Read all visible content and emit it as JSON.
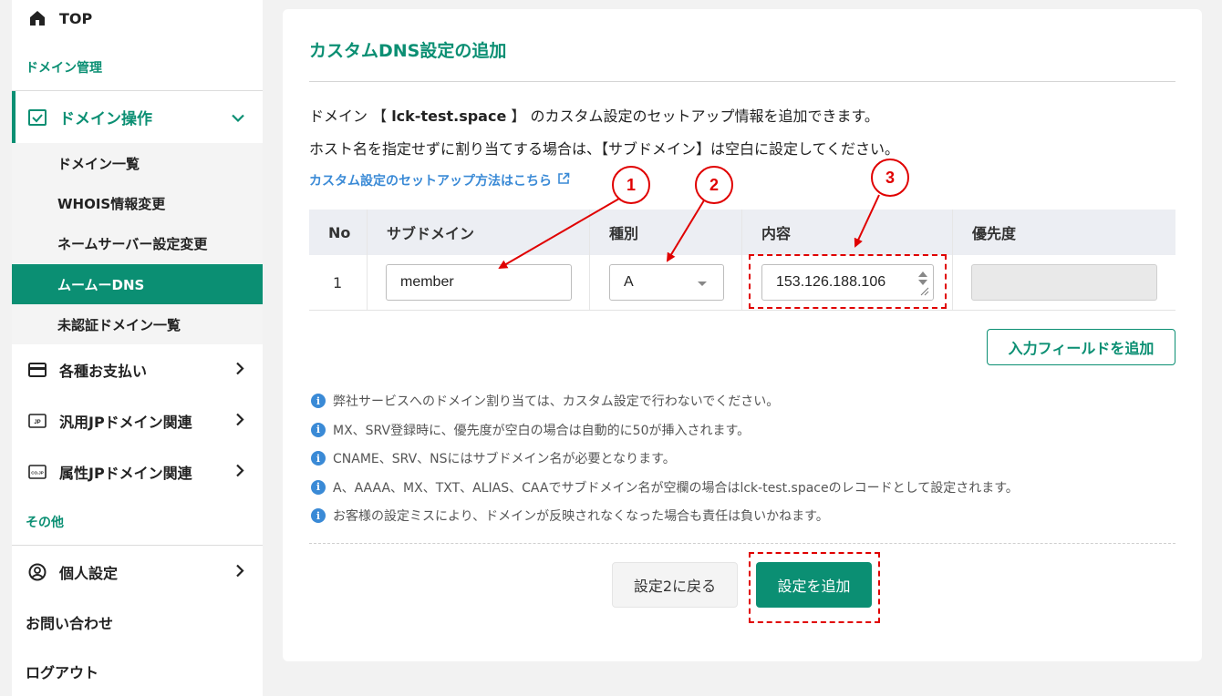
{
  "sidebar": {
    "top_label": "TOP",
    "section_domain": "ドメイン管理",
    "domain_ops_label": "ドメイン操作",
    "sub_items": [
      {
        "label": "ドメイン一覧",
        "active": false
      },
      {
        "label": "WHOIS情報変更",
        "active": false
      },
      {
        "label": "ネームサーバー設定変更",
        "active": false
      },
      {
        "label": "ムームーDNS",
        "active": true
      },
      {
        "label": "未認証ドメイン一覧",
        "active": false
      }
    ],
    "payments_label": "各種お支払い",
    "generic_jp_label": "汎用JPドメイン関連",
    "attr_jp_label": "属性JPドメイン関連",
    "section_other": "その他",
    "personal_label": "個人設定",
    "contact_label": "お問い合わせ",
    "logout_label": "ログアウト",
    "jp_badge": "JP",
    "cojp_badge": "CO.JP"
  },
  "main": {
    "title": "カスタムDNS設定の追加",
    "desc_prefix": "ドメイン 【 ",
    "domain": "lck-test.space",
    "desc_suffix": " 】 のカスタム設定のセットアップ情報を追加できます。",
    "desc2": "ホスト名を指定せずに割り当てする場合は、【サブドメイン】は空白に設定してください。",
    "help_link": "カスタム設定のセットアップ方法はこちら",
    "table": {
      "headers": [
        "No",
        "サブドメイン",
        "種別",
        "内容",
        "優先度"
      ],
      "row": {
        "no": "1",
        "subdomain": "member",
        "type": "A",
        "content": "153.126.188.106",
        "priority": ""
      }
    },
    "add_field_button": "入力フィールドを追加",
    "notes": [
      "弊社サービスへのドメイン割り当ては、カスタム設定で行わないでください。",
      "MX、SRV登録時に、優先度が空白の場合は自動的に50が挿入されます。",
      "CNAME、SRV、NSにはサブドメイン名が必要となります。",
      "A、AAAA、MX、TXT、ALIAS、CAAでサブドメイン名が空欄の場合はlck-test.spaceのレコードとして設定されます。",
      "お客様の設定ミスにより、ドメインが反映されなくなった場合も責任は負いかねます。"
    ],
    "back_button": "設定2に戻る",
    "submit_button": "設定を追加"
  },
  "annotations": [
    "1",
    "2",
    "3"
  ],
  "colors": {
    "brand": "#0b8f73",
    "link": "#3a8ad6",
    "annotation": "#e00000"
  }
}
